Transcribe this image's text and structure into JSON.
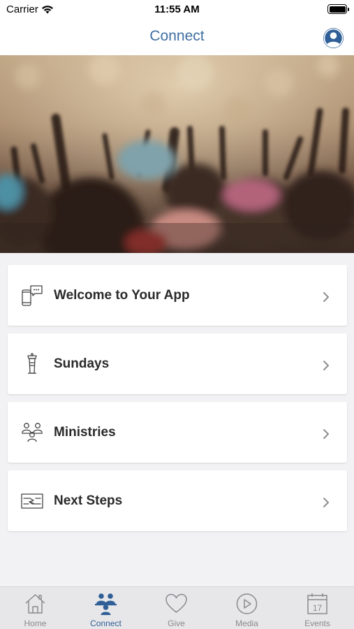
{
  "status_bar": {
    "carrier": "Carrier",
    "time": "11:55 AM"
  },
  "nav": {
    "title": "Connect"
  },
  "menu_items": [
    {
      "label": "Welcome to Your App",
      "icon": "phone-chat-icon"
    },
    {
      "label": "Sundays",
      "icon": "pulpit-icon"
    },
    {
      "label": "Ministries",
      "icon": "group-people-icon"
    },
    {
      "label": "Next Steps",
      "icon": "handshake-icon"
    }
  ],
  "tabs": [
    {
      "label": "Home",
      "icon": "home-icon",
      "active": false
    },
    {
      "label": "Connect",
      "icon": "connect-people-icon",
      "active": true
    },
    {
      "label": "Give",
      "icon": "heart-icon",
      "active": false
    },
    {
      "label": "Media",
      "icon": "play-icon",
      "active": false
    },
    {
      "label": "Events",
      "icon": "calendar-icon",
      "active": false,
      "badge": "17"
    }
  ],
  "colors": {
    "accent": "#2f5f96",
    "title": "#3f6fa3",
    "inactive_tab": "#8a8a8e"
  }
}
